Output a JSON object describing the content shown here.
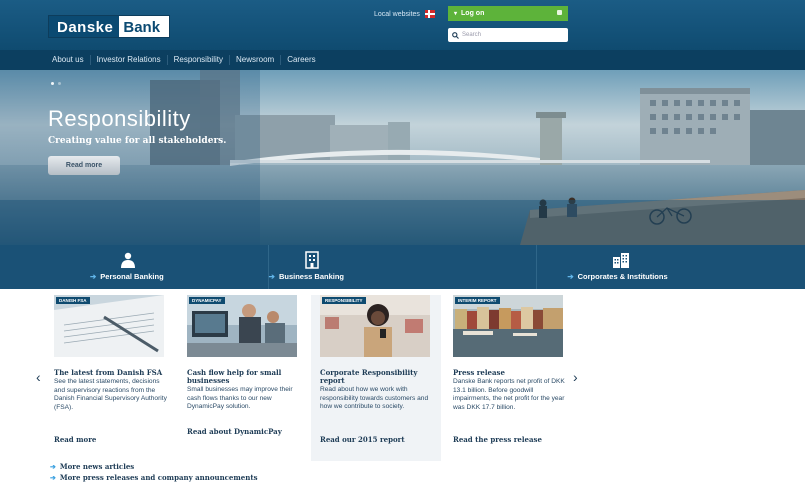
{
  "header": {
    "logo_part1": "Danske",
    "logo_part2": "Bank",
    "local_websites": "Local websites",
    "logon_label": "Log on",
    "search_placeholder": "Search"
  },
  "nav": [
    "About us",
    "Investor Relations",
    "Responsibility",
    "Newsroom",
    "Careers"
  ],
  "hero": {
    "title": "Responsibility",
    "subtitle": "Creating value for all stakeholders.",
    "button": "Read more"
  },
  "banking": [
    {
      "label": "Personal Banking",
      "icon": "person-icon"
    },
    {
      "label": "Business Banking",
      "icon": "building-icon"
    },
    {
      "label": "Corporates & Institutions",
      "icon": "buildings-icon"
    }
  ],
  "cards": [
    {
      "tag": "DANISH FSA",
      "title": "The latest from Danish FSA",
      "body": "See the latest statements, decisions and supervisory reactions from the Danish Financial Supervisory Authority (FSA).",
      "link": "Read more"
    },
    {
      "tag": "DYNAMICPAY",
      "title": "Cash flow help for small businesses",
      "body": "Small businesses may improve their cash flows thanks to our new DynamicPay solution.",
      "link": "Read about DynamicPay"
    },
    {
      "tag": "RESPONSIBILITY",
      "title": "Corporate Responsibility report",
      "body": "Read about how we work with responsibility towards customers and how we contribute to society.",
      "link": "Read our 2015 report"
    },
    {
      "tag": "INTERIM REPORT",
      "title": "Press release",
      "body": "Danske Bank reports net profit of DKK 13.1 billion. Before goodwill impairments, the net profit for the year was DKK 17.7 billion.",
      "link": "Read the press release"
    }
  ],
  "more_links": [
    "More news articles",
    "More press releases and company announcements"
  ],
  "colors": {
    "brand": "#0f4b70",
    "logon": "#5db33a",
    "accent": "#3aa0e0"
  }
}
